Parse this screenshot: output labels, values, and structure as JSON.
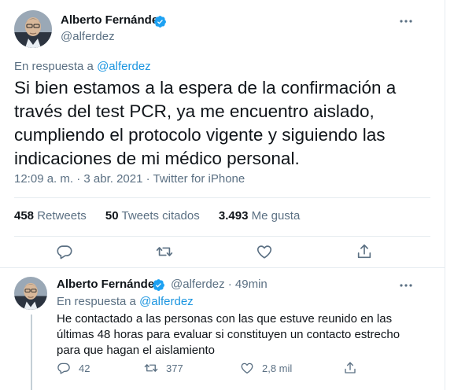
{
  "tweet": {
    "author_name": "Alberto Fernández",
    "author_handle": "@alferdez",
    "reply_prefix": "En respuesta a ",
    "reply_to": "@alferdez",
    "text": "Si bien estamos a la espera de la confirmación a través del test PCR, ya me encuentro aislado, cumpliendo el protocolo vigente y siguiendo las indicaciones de mi médico personal.",
    "meta": "12:09 a. m. · 3 abr. 2021 · Twitter for iPhone",
    "stats": {
      "retweets_count": "458",
      "retweets_label": "Retweets",
      "quotes_count": "50",
      "quotes_label": "Tweets citados",
      "likes_count": "3.493",
      "likes_label": "Me gusta"
    },
    "actions": [
      "reply-icon",
      "retweet-icon",
      "like-icon",
      "share-icon"
    ]
  },
  "reply_tweet": {
    "author_name": "Alberto Fernández",
    "author_handle": "@alferdez · 49min",
    "reply_prefix": "En respuesta a ",
    "reply_to": "@alferdez",
    "text": "He contactado a las personas con las que estuve reunido en las últimas 48 horas para evaluar si constituyen un contacto estrecho para que hagan el aislamiento",
    "replies": "42",
    "retweets": "377",
    "likes": "2,8 mil"
  },
  "colors": {
    "verified": "#1da1f2",
    "link": "#1b95e0",
    "muted": "#5b7083"
  }
}
